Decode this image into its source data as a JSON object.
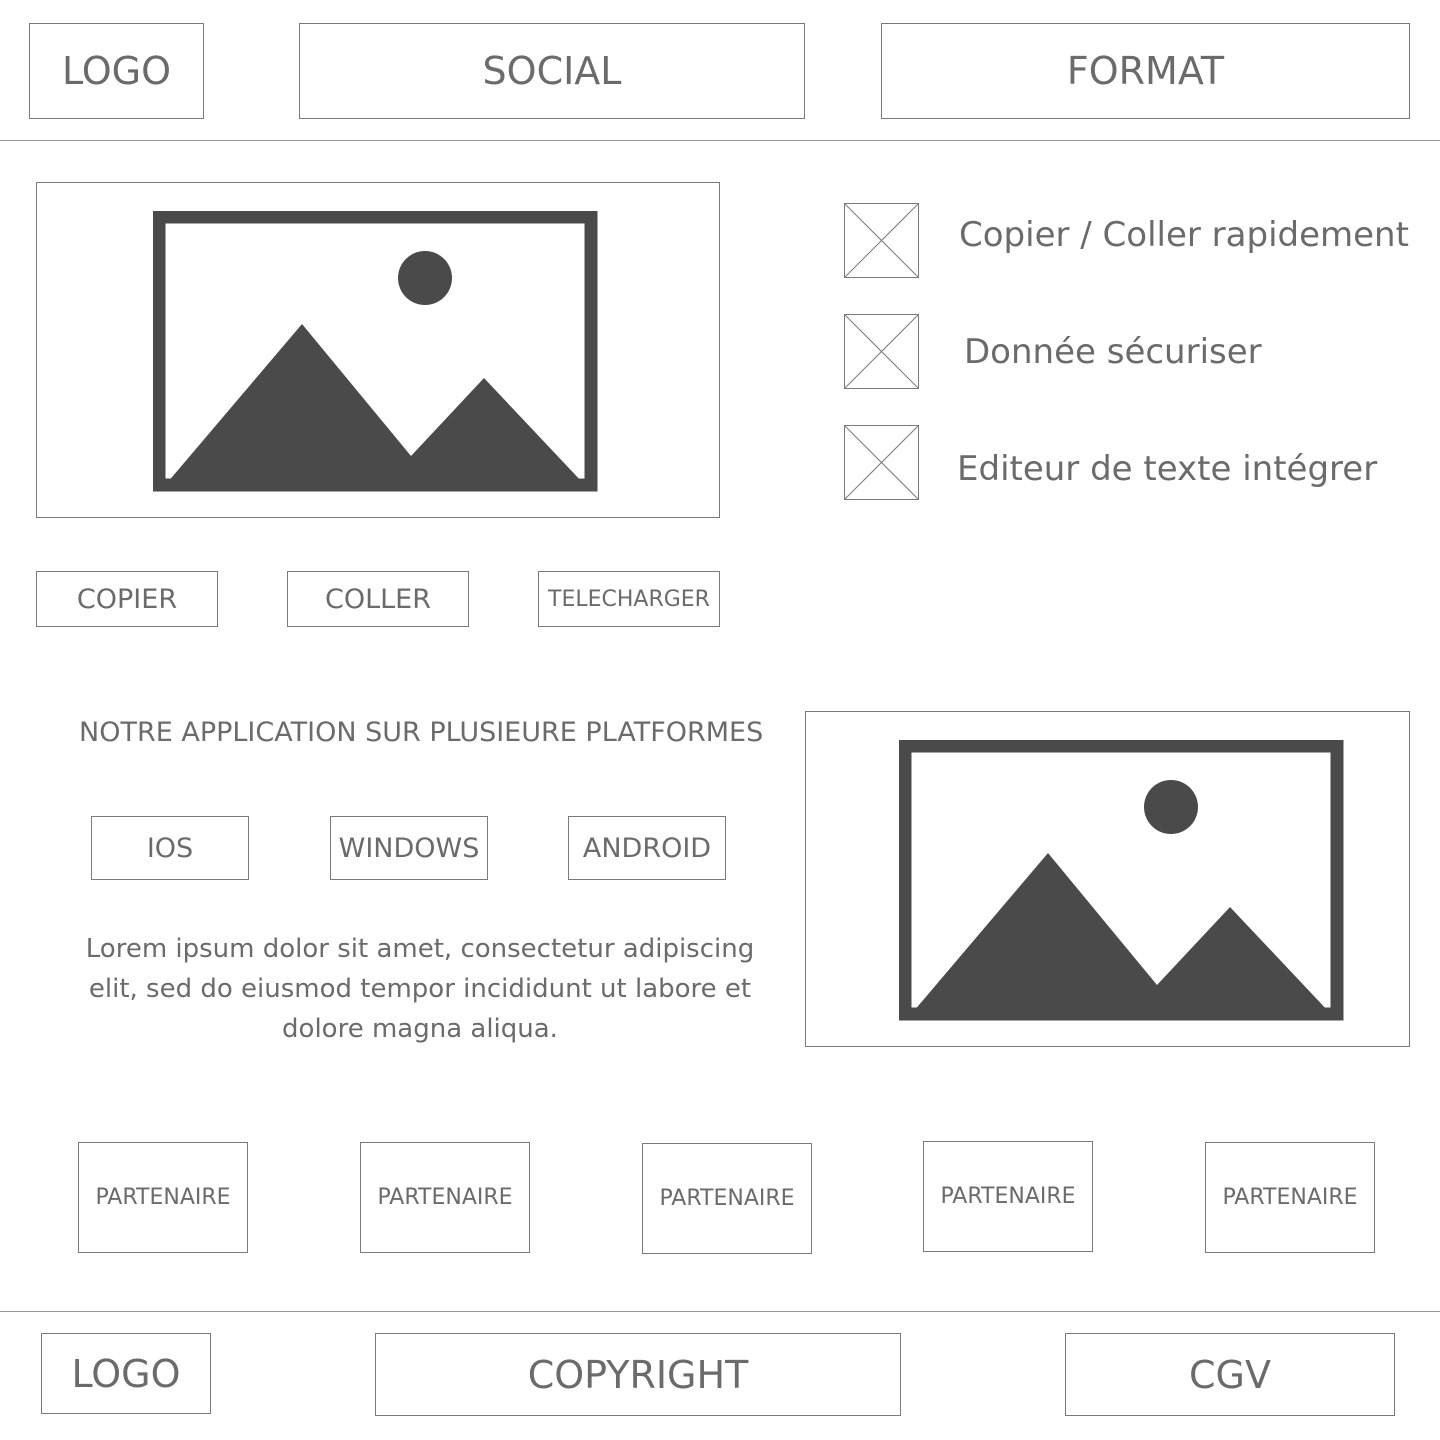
{
  "header": {
    "logo": "LOGO",
    "social": "SOCIAL",
    "format": "FORMAT"
  },
  "hero": {
    "image_icon": "image-placeholder-icon",
    "features": [
      {
        "icon": "placeholder-x-icon",
        "label": "Copier / Coller rapidement"
      },
      {
        "icon": "placeholder-x-icon",
        "label": "Donnée sécuriser"
      },
      {
        "icon": "placeholder-x-icon",
        "label": "Editeur de texte intégrer"
      }
    ],
    "actions": {
      "copy": "COPIER",
      "paste": "COLLER",
      "download": "TELECHARGER"
    }
  },
  "platforms": {
    "title": "NOTRE APPLICATION SUR PLUSIEURE PLATFORMES",
    "ios": "IOS",
    "windows": "WINDOWS",
    "android": "ANDROID",
    "description": "Lorem ipsum dolor sit amet, consectetur adipiscing elit, sed do eiusmod tempor incididunt ut labore et dolore magna aliqua.",
    "image_icon": "image-placeholder-icon"
  },
  "partners": [
    "PARTENAIRE",
    "PARTENAIRE",
    "PARTENAIRE",
    "PARTENAIRE",
    "PARTENAIRE"
  ],
  "footer": {
    "logo": "LOGO",
    "copyright": "COPYRIGHT",
    "cgv": "CGV"
  },
  "colors": {
    "border": "#7a7a7a",
    "text": "#6b6b6b",
    "image_fill": "#4a4a4a"
  }
}
